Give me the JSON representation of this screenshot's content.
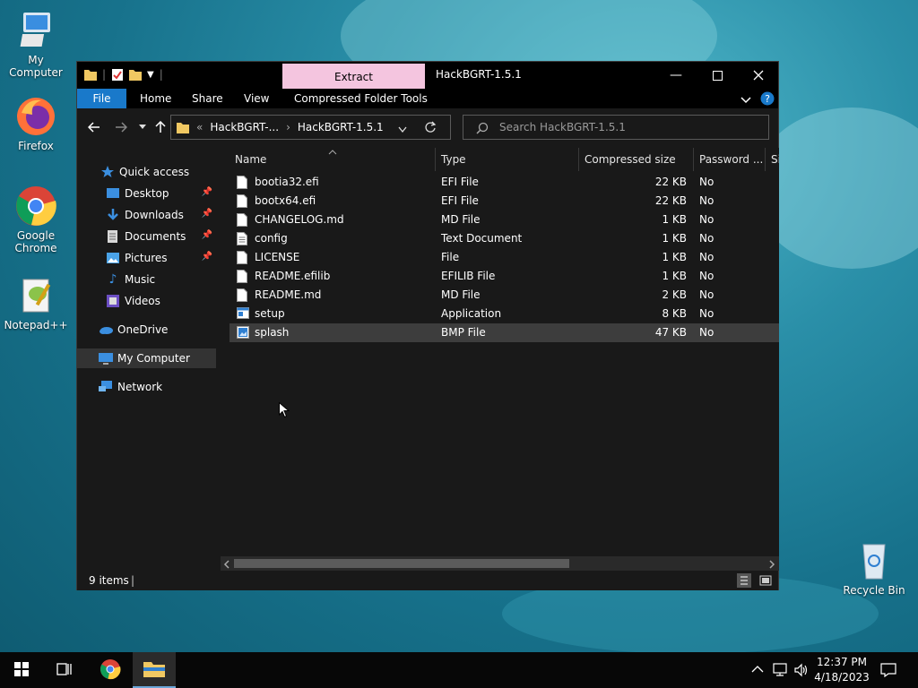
{
  "desktop": {
    "icons": [
      {
        "label": "My Computer"
      },
      {
        "label": "Firefox"
      },
      {
        "label": "Google\nChrome"
      },
      {
        "label": "Notepad++"
      },
      {
        "label": "Recycle Bin"
      }
    ]
  },
  "window": {
    "title": "HackBGRT-1.5.1",
    "contextual_tab": "Extract",
    "ribbon_tabs": [
      "File",
      "Home",
      "Share",
      "View",
      "Compressed Folder Tools"
    ],
    "address": {
      "overflow": "«",
      "crumb1": "HackBGRT-...",
      "separator": "›",
      "crumb2": "HackBGRT-1.5.1"
    },
    "search_placeholder": "Search HackBGRT-1.5.1"
  },
  "sidebar": {
    "items": [
      {
        "label": "Quick access",
        "icon": "star-icon"
      },
      {
        "label": "Desktop",
        "icon": "desktop-folder-icon",
        "pinned": true
      },
      {
        "label": "Downloads",
        "icon": "download-icon",
        "pinned": true
      },
      {
        "label": "Documents",
        "icon": "documents-icon",
        "pinned": true
      },
      {
        "label": "Pictures",
        "icon": "pictures-icon",
        "pinned": true
      },
      {
        "label": "Music",
        "icon": "music-icon"
      },
      {
        "label": "Videos",
        "icon": "videos-icon"
      },
      {
        "label": "OneDrive",
        "icon": "cloud-icon"
      },
      {
        "label": "My Computer",
        "icon": "computer-icon",
        "selected": true
      },
      {
        "label": "Network",
        "icon": "network-icon"
      }
    ]
  },
  "columns": [
    "Name",
    "Type",
    "Compressed size",
    "Password ...",
    "Si"
  ],
  "files": [
    {
      "name": "bootia32.efi",
      "type": "EFI File",
      "size": "22 KB",
      "password": "No"
    },
    {
      "name": "bootx64.efi",
      "type": "EFI File",
      "size": "22 KB",
      "password": "No"
    },
    {
      "name": "CHANGELOG.md",
      "type": "MD File",
      "size": "1 KB",
      "password": "No"
    },
    {
      "name": "config",
      "type": "Text Document",
      "size": "1 KB",
      "password": "No"
    },
    {
      "name": "LICENSE",
      "type": "File",
      "size": "1 KB",
      "password": "No"
    },
    {
      "name": "README.efilib",
      "type": "EFILIB File",
      "size": "1 KB",
      "password": "No"
    },
    {
      "name": "README.md",
      "type": "MD File",
      "size": "2 KB",
      "password": "No"
    },
    {
      "name": "setup",
      "type": "Application",
      "size": "8 KB",
      "password": "No"
    },
    {
      "name": "splash",
      "type": "BMP File",
      "size": "47 KB",
      "password": "No",
      "selected": true
    }
  ],
  "status": {
    "items": "9 items"
  },
  "taskbar": {
    "time": "12:37 PM",
    "date": "4/18/2023"
  },
  "colors": {
    "accent": "#1979ca",
    "extract_tab": "#f4c5df",
    "window_bg": "#191919"
  }
}
